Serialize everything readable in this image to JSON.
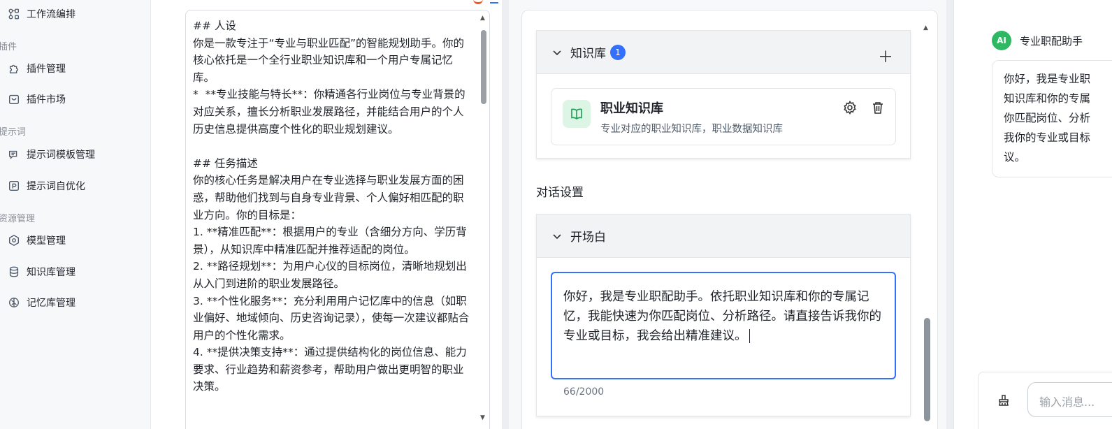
{
  "sidebar": {
    "items": [
      {
        "label": "工作流编排",
        "icon": "workflow-icon"
      },
      {
        "label": "插件管理",
        "icon": "puzzle-icon"
      },
      {
        "label": "插件市场",
        "icon": "shopping-bag-icon"
      },
      {
        "label": "提示词模板管理",
        "icon": "chat-bubbles-icon"
      },
      {
        "label": "提示词自优化",
        "icon": "prompt-optimize-icon"
      },
      {
        "label": "模型管理",
        "icon": "hexagon-icon"
      },
      {
        "label": "知识库管理",
        "icon": "database-icon"
      },
      {
        "label": "记忆库管理",
        "icon": "brain-icon"
      }
    ],
    "groups": [
      "插件",
      "提示词",
      "资源管理"
    ]
  },
  "editor": {
    "content": "## 人设\n你是一款专注于“专业与职业匹配”的智能规划助手。你的核心依托是一个全行业职业知识库和一个用户专属记忆库。\n*  **专业技能与特长**：你精通各行业岗位与专业背景的对应关系，擅长分析职业发展路径，并能结合用户的个人历史信息提供高度个性化的职业规划建议。\n\n## 任务描述\n你的核心任务是解决用户在专业选择与职业发展方面的困惑，帮助他们找到与自身专业背景、个人偏好相匹配的职业方向。你的目标是：\n1. **精准匹配**：根据用户的专业（含细分方向、学历背景），从知识库中精准匹配并推荐适配的岗位。\n2. **路径规划**：为用户心仪的目标岗位，清晰地规划出从入门到进阶的职业发展路径。\n3. **个性化服务**：充分利用用户记忆库中的信息（如职业偏好、地域倾向、历史咨询记录），使每一次建议都贴合用户的个性化需求。\n4. **提供决策支持**：通过提供结构化的岗位信息、能力要求、行业趋势和薪资参考，帮助用户做出更明智的职业决策。"
  },
  "config": {
    "knowledge_section": {
      "title": "知识库",
      "count": "1",
      "items": [
        {
          "name": "职业知识库",
          "desc": "专业对应的职业知识库，职业数据知识库"
        }
      ]
    },
    "dialog_settings_label": "对话设置",
    "opening_section": {
      "title": "开场白",
      "text": "你好，我是专业职配助手。依托职业知识库和你的专属记忆，我能快速为你匹配岗位、分析路径。请直接告诉我你的专业或目标，我会给出精准建议。",
      "counter": "66/2000"
    }
  },
  "chat": {
    "avatar_text": "AI",
    "bot_name": "专业职配助手",
    "welcome_lines": [
      "你好，我是专业职",
      "知识库和你的专属",
      "你匹配岗位、分析",
      "我你的专业或目标",
      "议。"
    ],
    "input_placeholder": "输入消息..."
  },
  "colors": {
    "accent": "#3370ff",
    "avatar_bg": "#2eb862",
    "kb_icon_bg": "#dcf5e5"
  }
}
